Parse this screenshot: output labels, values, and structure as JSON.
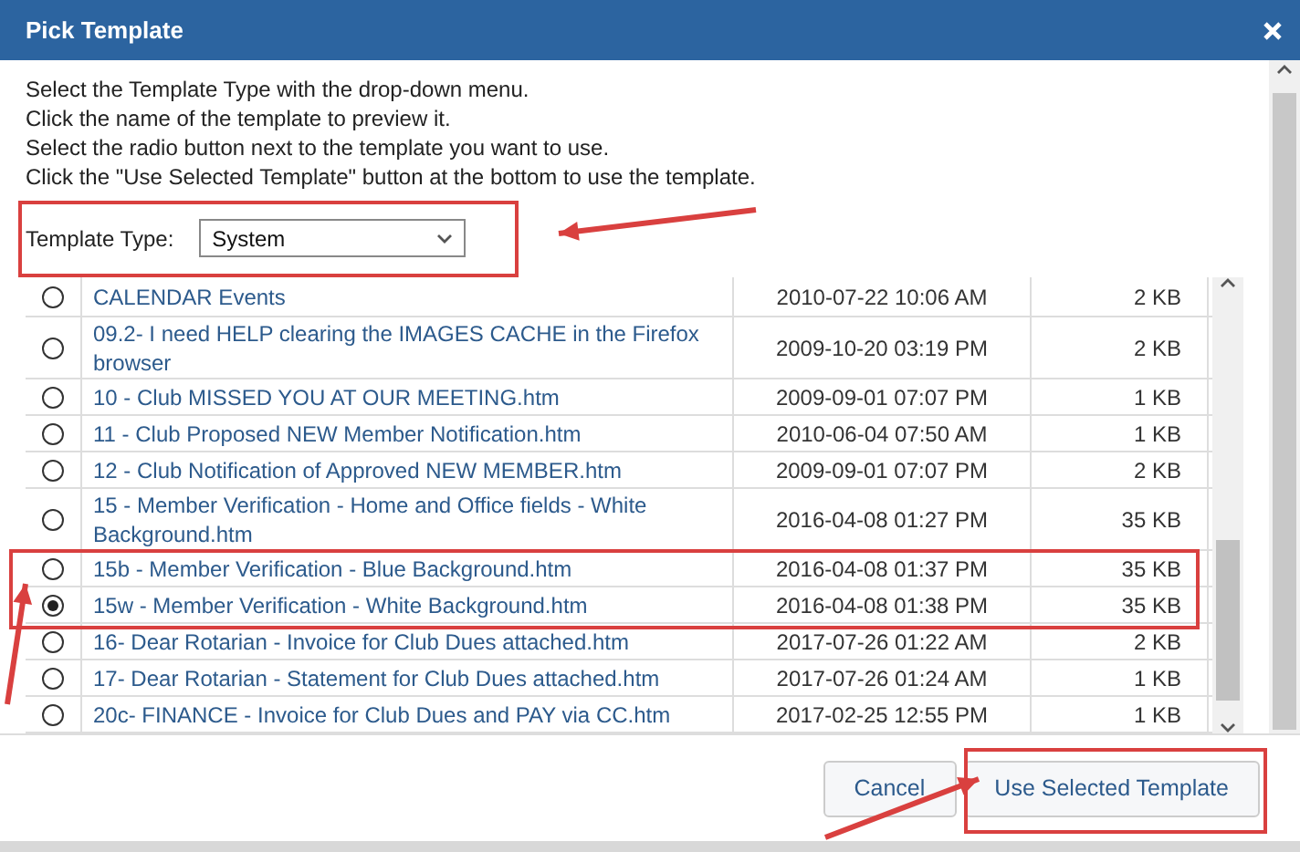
{
  "window": {
    "title": "Pick Template"
  },
  "instructions": [
    "Select the Template Type with the drop-down menu.",
    "Click the name of the template to preview it.",
    "Select the radio button next to the template you want to use.",
    "Click the \"Use Selected Template\" button at the bottom to use the template."
  ],
  "template_type": {
    "label": "Template Type:",
    "value": "System"
  },
  "templates": [
    {
      "name": "CALENDAR Events",
      "modified": "2010-07-22 10:06 AM",
      "size": "2 KB",
      "selected": false
    },
    {
      "name": "09.2- I need HELP clearing the IMAGES CACHE in the Firefox browser",
      "modified": "2009-10-20 03:19 PM",
      "size": "2 KB",
      "selected": false
    },
    {
      "name": "10 - Club MISSED YOU AT OUR MEETING.htm",
      "modified": "2009-09-01 07:07 PM",
      "size": "1 KB",
      "selected": false
    },
    {
      "name": "11 - Club Proposed NEW Member Notification.htm",
      "modified": "2010-06-04 07:50 AM",
      "size": "1 KB",
      "selected": false
    },
    {
      "name": "12 - Club Notification of Approved NEW MEMBER.htm",
      "modified": "2009-09-01 07:07 PM",
      "size": "2 KB",
      "selected": false
    },
    {
      "name": "15 - Member Verification - Home and Office fields - White Background.htm",
      "modified": "2016-04-08 01:27 PM",
      "size": "35 KB",
      "selected": false
    },
    {
      "name": "15b - Member Verification - Blue Background.htm",
      "modified": "2016-04-08 01:37 PM",
      "size": "35 KB",
      "selected": false
    },
    {
      "name": "15w - Member Verification - White Background.htm",
      "modified": "2016-04-08 01:38 PM",
      "size": "35 KB",
      "selected": true
    },
    {
      "name": "16- Dear Rotarian - Invoice for Club Dues attached.htm",
      "modified": "2017-07-26 01:22 AM",
      "size": "2 KB",
      "selected": false
    },
    {
      "name": "17- Dear Rotarian - Statement for Club Dues attached.htm",
      "modified": "2017-07-26 01:24 AM",
      "size": "1 KB",
      "selected": false
    },
    {
      "name": "20c- FINANCE - Invoice for Club Dues and PAY via CC.htm",
      "modified": "2017-02-25 12:55 PM",
      "size": "1 KB",
      "selected": false
    }
  ],
  "buttons": [
    "Cancel",
    "Use Selected Template"
  ]
}
